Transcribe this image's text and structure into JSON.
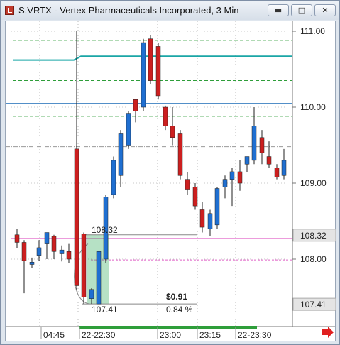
{
  "window": {
    "title": "S.VRTX - Vertex Pharmaceuticals Incorporated, 3 Min",
    "minimize_icon": "minimize-icon",
    "restore_icon": "restore-icon",
    "close_icon": "close-icon"
  },
  "price_axis": {
    "ticks": [
      "111.00",
      "110.00",
      "109.00",
      "108.00"
    ],
    "markers": [
      {
        "label": "108.32",
        "bg": "#e4e4e4",
        "fg": "#111"
      },
      {
        "label": "107.41",
        "bg": "#e4e4e4",
        "fg": "#111"
      }
    ]
  },
  "time_axis": {
    "labels": [
      "04:45",
      "22-22:30",
      "23:00",
      "23:15",
      "22-23:30"
    ],
    "scroll_icon": "right-arrow-icon"
  },
  "measurement": {
    "high_label": "108.32",
    "low_label": "107.41",
    "change_label": "$0.91",
    "percent_label": "0.84 %"
  },
  "colors": {
    "up": "#1f6fd1",
    "down": "#cc1f1f",
    "vwap": "#1aa6a6",
    "band": "#2e9e3a",
    "pink": "#e060c8",
    "blue_line": "#3a7fc0",
    "selection": "#2ea85a"
  },
  "chart_data": {
    "type": "candlestick",
    "ylim": [
      107.41,
      111.12
    ],
    "x": [
      "04:45",
      "22-22:30",
      "23:00",
      "23:15",
      "22-23:30"
    ],
    "candles": [
      {
        "o": 108.32,
        "h": 108.4,
        "l": 108.15,
        "c": 108.22
      },
      {
        "o": 108.22,
        "h": 108.25,
        "l": 107.55,
        "c": 107.98
      },
      {
        "o": 107.93,
        "h": 108.02,
        "l": 107.88,
        "c": 107.96
      },
      {
        "o": 108.05,
        "h": 108.25,
        "l": 107.98,
        "c": 108.15
      },
      {
        "o": 108.2,
        "h": 108.35,
        "l": 108.0,
        "c": 108.35
      },
      {
        "o": 108.3,
        "h": 108.32,
        "l": 108.0,
        "c": 108.1
      },
      {
        "o": 108.07,
        "h": 108.18,
        "l": 107.97,
        "c": 108.12
      },
      {
        "o": 108.1,
        "h": 108.2,
        "l": 107.95,
        "c": 108.0
      },
      {
        "o": 109.45,
        "h": 111.0,
        "l": 107.6,
        "c": 107.65
      },
      {
        "o": 108.33,
        "h": 108.35,
        "l": 107.41,
        "c": 107.5
      },
      {
        "o": 107.48,
        "h": 107.62,
        "l": 107.41,
        "c": 107.6
      },
      {
        "o": 107.41,
        "h": 108.1,
        "l": 107.41,
        "c": 108.1
      },
      {
        "o": 108.0,
        "h": 108.85,
        "l": 107.95,
        "c": 108.82
      },
      {
        "o": 108.85,
        "h": 109.35,
        "l": 108.8,
        "c": 109.3
      },
      {
        "o": 109.1,
        "h": 109.7,
        "l": 108.95,
        "c": 109.65
      },
      {
        "o": 109.5,
        "h": 109.95,
        "l": 109.45,
        "c": 109.92
      },
      {
        "o": 110.1,
        "h": 110.1,
        "l": 109.8,
        "c": 109.95
      },
      {
        "o": 110.0,
        "h": 110.9,
        "l": 109.95,
        "c": 110.85
      },
      {
        "o": 110.9,
        "h": 110.95,
        "l": 110.3,
        "c": 110.35
      },
      {
        "o": 110.8,
        "h": 110.85,
        "l": 110.1,
        "c": 110.15
      },
      {
        "o": 110.0,
        "h": 110.02,
        "l": 109.7,
        "c": 109.75
      },
      {
        "o": 109.75,
        "h": 110.0,
        "l": 109.5,
        "c": 109.6
      },
      {
        "o": 109.65,
        "h": 109.7,
        "l": 109.05,
        "c": 109.1
      },
      {
        "o": 109.05,
        "h": 109.15,
        "l": 108.85,
        "c": 108.92
      },
      {
        "o": 108.95,
        "h": 109.0,
        "l": 108.65,
        "c": 108.7
      },
      {
        "o": 108.65,
        "h": 108.75,
        "l": 108.35,
        "c": 108.42
      },
      {
        "o": 108.4,
        "h": 108.65,
        "l": 108.3,
        "c": 108.6
      },
      {
        "o": 108.45,
        "h": 108.95,
        "l": 108.4,
        "c": 108.93
      },
      {
        "o": 108.95,
        "h": 109.1,
        "l": 108.8,
        "c": 109.05
      },
      {
        "o": 109.05,
        "h": 109.2,
        "l": 108.7,
        "c": 109.15
      },
      {
        "o": 109.15,
        "h": 109.3,
        "l": 108.9,
        "c": 109.0
      },
      {
        "o": 109.25,
        "h": 109.35,
        "l": 109.15,
        "c": 109.35
      },
      {
        "o": 109.3,
        "h": 110.0,
        "l": 109.25,
        "c": 109.75
      },
      {
        "o": 109.6,
        "h": 109.7,
        "l": 109.25,
        "c": 109.4
      },
      {
        "o": 109.35,
        "h": 109.55,
        "l": 109.2,
        "c": 109.25
      },
      {
        "o": 109.2,
        "h": 109.25,
        "l": 109.05,
        "c": 109.08
      },
      {
        "o": 109.1,
        "h": 109.45,
        "l": 109.05,
        "c": 109.3
      }
    ],
    "levels": {
      "green_dashed": [
        110.88,
        110.35,
        109.88,
        108.32,
        109.85
      ],
      "vwap_pre": 110.62,
      "vwap_post": 110.67,
      "blue_solid": 110.05,
      "pink": [
        108.5,
        108.25,
        108.0
      ]
    }
  }
}
